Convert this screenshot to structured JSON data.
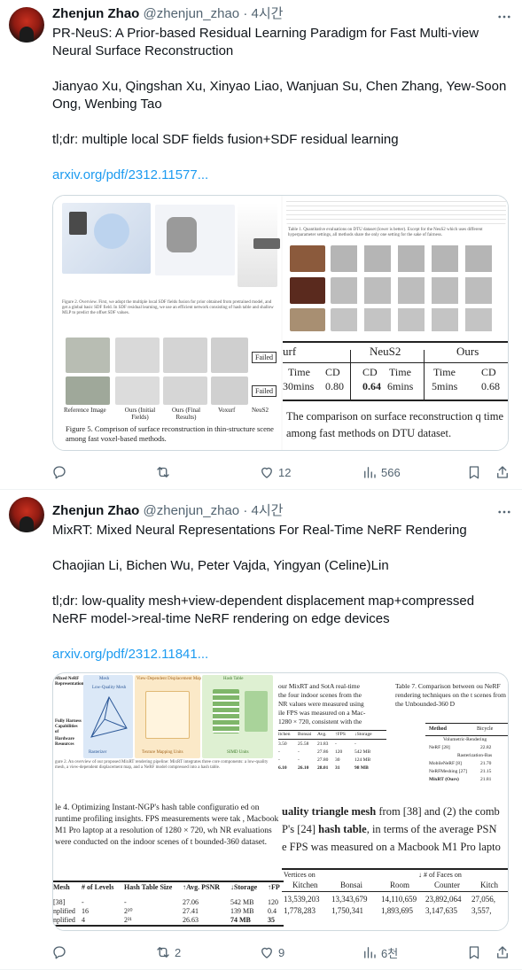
{
  "tweets": [
    {
      "author": {
        "name": "Zhenjun Zhao",
        "handle": "@zhenjun_zhao",
        "time": "· 4시간"
      },
      "title": "PR-NeuS: A Prior-based Residual Learning Paradigm for Fast Multi-view Neural Surface Reconstruction",
      "authors": "Jianyao Xu, Qingshan Xu, Xinyao Liao, Wanjuan Su, Chen Zhang, Yew-Soon Ong, Wenbing Tao",
      "tldr": "tl;dr: multiple local SDF fields fusion+SDF residual learning",
      "link": "arxiv.org/pdf/2312.11577...",
      "media": {
        "fig_caption": "Figure 5.  Comprison of surface reconstruction in thin-structure scene among fast voxel-based methods.",
        "fig_labels": [
          "Reference Image",
          "Ours (Initial Fields)",
          "Ours (Final Results)",
          "Voxurf",
          "NeuS2"
        ],
        "failed": [
          "Failed",
          "Failed"
        ],
        "table_headers": [
          "urf",
          "NeuS2",
          "Ours"
        ],
        "table_sub": [
          "Time",
          "CD",
          "Time",
          "CD",
          "Time",
          "CD"
        ],
        "table_vals": [
          "30mins",
          "0.80",
          "6mins",
          "0.64",
          "5mins",
          "0.68"
        ],
        "table_caption": "The comparison on surface reconstruction q time among fast methods on DTU dataset."
      },
      "actions": {
        "reply": "",
        "retweet": "",
        "like": "12",
        "views": "566"
      }
    },
    {
      "author": {
        "name": "Zhenjun Zhao",
        "handle": "@zhenjun_zhao",
        "time": "· 4시간"
      },
      "title": "MixRT: Mixed Neural Representations For Real-Time NeRF Rendering",
      "authors": "Chaojian Li, Bichen Wu, Peter Vajda, Yingyan (Celine)Lin",
      "tldr": "tl;dr: low-quality mesh+view-dependent displacement map+compressed NeRF model->real-time NeRF rendering on edge devices",
      "link": "arxiv.org/pdf/2312.11841...",
      "media": {
        "diagram_labels": [
          "Mesh",
          "View-Dependent Displacement Map",
          "Hash Table",
          "Low-Quality Mesh",
          "Rasterizer",
          "Texture Mapping Units",
          "SIMD Units"
        ],
        "row_labels": [
          "Mixed NeRF Representations",
          "Fully Harness Capabilities of",
          "Hardware Resources"
        ],
        "text_lines": [
          "our MixRT and SotA real-time",
          "the four indoor scenes from the",
          "NR values were measured using",
          "ile FPS was measured on a Mac-",
          "1280 × 720, consistent with the"
        ],
        "t7_caption": "Table 7.  Comparison between ou NeRF rendering techniques on the t scenes from the Unbounded-360 D",
        "t7_header": [
          "Method",
          "Bicycle"
        ],
        "t7_group": "Volumetric-Rendering",
        "t7_group2": "Rasterization-Bas",
        "t7_rows": [
          [
            "MobileNeRF [8]",
            "21.70"
          ],
          [
            "NeRFMeshing [27]",
            "21.15"
          ],
          [
            "MixRT (Ours)",
            "21.81"
          ]
        ],
        "t7_first": [
          "NeRF [28]",
          "22.82"
        ],
        "mid_header": [
          "itchen",
          "Bonsai",
          "Avg.",
          "↑FPS",
          "↓Storage"
        ],
        "mid_rows": [
          [
            "3.50",
            "25.58",
            "21.83",
            "-",
            "-"
          ],
          [
            "-",
            "-",
            "27.86",
            "120",
            "542 MB"
          ],
          [
            "-",
            "-",
            "27.80",
            "30",
            "124 MB"
          ],
          [
            "6.10",
            "26.10",
            "28.01",
            "31",
            "98 MB"
          ]
        ],
        "para1": "le 4.  Optimizing Instant-NGP's hash table configuratio ed on runtime profiling insights. FPS measurements were tak , Macbook M1 Pro laptop at a resolution of 1280 × 720, wh NR evaluations were conducted on the indoor scenes of t bounded-360 dataset.",
        "para2a": "uality triangle mesh",
        "para2b": " from [38] and (2) the comb",
        "para3a": "P's [24] ",
        "para3b": "hash table",
        "para3c": ", in terms of the average PSN",
        "para4": "e FPS was measured on a Macbook M1 Pro lapto",
        "bl_header": [
          "Mesh",
          "# of Levels",
          "Hash Table Size",
          "↑Avg. PSNR",
          "↓Storage",
          "↑FP"
        ],
        "bl_rows": [
          [
            "[38]",
            "-",
            "-",
            "27.06",
            "542 MB",
            "120"
          ],
          [
            "nplified",
            "16",
            "2^20",
            "27.41",
            "139 MB",
            "0.4"
          ],
          [
            "nplified",
            "4",
            "2^21",
            "26.63",
            "74 MB",
            "35"
          ]
        ],
        "br_title": "↓ # of Faces on",
        "br_left": "Vertices on",
        "br_header": [
          "Kitchen",
          "Bonsai",
          "Room",
          "Counter",
          "Kitch"
        ],
        "br_rows": [
          [
            "13,539,203",
            "13,343,679",
            "14,110,659",
            "23,892,064",
            "27,056,"
          ],
          [
            "1,778,283",
            "1,750,341",
            "1,893,695",
            "3,147,635",
            "3,557,"
          ]
        ]
      },
      "actions": {
        "reply": "",
        "retweet": "2",
        "like": "9",
        "views": "6천"
      }
    }
  ]
}
